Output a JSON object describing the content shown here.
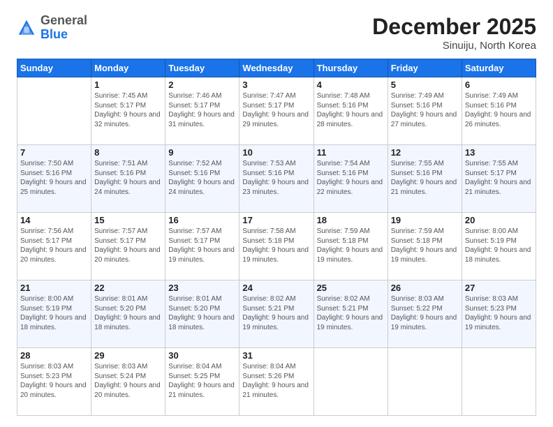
{
  "header": {
    "logo_general": "General",
    "logo_blue": "Blue",
    "month": "December 2025",
    "location": "Sinuiju, North Korea"
  },
  "days_of_week": [
    "Sunday",
    "Monday",
    "Tuesday",
    "Wednesday",
    "Thursday",
    "Friday",
    "Saturday"
  ],
  "weeks": [
    [
      {
        "day": "",
        "sunrise": "",
        "sunset": "",
        "daylight": ""
      },
      {
        "day": "1",
        "sunrise": "Sunrise: 7:45 AM",
        "sunset": "Sunset: 5:17 PM",
        "daylight": "Daylight: 9 hours and 32 minutes."
      },
      {
        "day": "2",
        "sunrise": "Sunrise: 7:46 AM",
        "sunset": "Sunset: 5:17 PM",
        "daylight": "Daylight: 9 hours and 31 minutes."
      },
      {
        "day": "3",
        "sunrise": "Sunrise: 7:47 AM",
        "sunset": "Sunset: 5:17 PM",
        "daylight": "Daylight: 9 hours and 29 minutes."
      },
      {
        "day": "4",
        "sunrise": "Sunrise: 7:48 AM",
        "sunset": "Sunset: 5:16 PM",
        "daylight": "Daylight: 9 hours and 28 minutes."
      },
      {
        "day": "5",
        "sunrise": "Sunrise: 7:49 AM",
        "sunset": "Sunset: 5:16 PM",
        "daylight": "Daylight: 9 hours and 27 minutes."
      },
      {
        "day": "6",
        "sunrise": "Sunrise: 7:49 AM",
        "sunset": "Sunset: 5:16 PM",
        "daylight": "Daylight: 9 hours and 26 minutes."
      }
    ],
    [
      {
        "day": "7",
        "sunrise": "Sunrise: 7:50 AM",
        "sunset": "Sunset: 5:16 PM",
        "daylight": "Daylight: 9 hours and 25 minutes."
      },
      {
        "day": "8",
        "sunrise": "Sunrise: 7:51 AM",
        "sunset": "Sunset: 5:16 PM",
        "daylight": "Daylight: 9 hours and 24 minutes."
      },
      {
        "day": "9",
        "sunrise": "Sunrise: 7:52 AM",
        "sunset": "Sunset: 5:16 PM",
        "daylight": "Daylight: 9 hours and 24 minutes."
      },
      {
        "day": "10",
        "sunrise": "Sunrise: 7:53 AM",
        "sunset": "Sunset: 5:16 PM",
        "daylight": "Daylight: 9 hours and 23 minutes."
      },
      {
        "day": "11",
        "sunrise": "Sunrise: 7:54 AM",
        "sunset": "Sunset: 5:16 PM",
        "daylight": "Daylight: 9 hours and 22 minutes."
      },
      {
        "day": "12",
        "sunrise": "Sunrise: 7:55 AM",
        "sunset": "Sunset: 5:16 PM",
        "daylight": "Daylight: 9 hours and 21 minutes."
      },
      {
        "day": "13",
        "sunrise": "Sunrise: 7:55 AM",
        "sunset": "Sunset: 5:17 PM",
        "daylight": "Daylight: 9 hours and 21 minutes."
      }
    ],
    [
      {
        "day": "14",
        "sunrise": "Sunrise: 7:56 AM",
        "sunset": "Sunset: 5:17 PM",
        "daylight": "Daylight: 9 hours and 20 minutes."
      },
      {
        "day": "15",
        "sunrise": "Sunrise: 7:57 AM",
        "sunset": "Sunset: 5:17 PM",
        "daylight": "Daylight: 9 hours and 20 minutes."
      },
      {
        "day": "16",
        "sunrise": "Sunrise: 7:57 AM",
        "sunset": "Sunset: 5:17 PM",
        "daylight": "Daylight: 9 hours and 19 minutes."
      },
      {
        "day": "17",
        "sunrise": "Sunrise: 7:58 AM",
        "sunset": "Sunset: 5:18 PM",
        "daylight": "Daylight: 9 hours and 19 minutes."
      },
      {
        "day": "18",
        "sunrise": "Sunrise: 7:59 AM",
        "sunset": "Sunset: 5:18 PM",
        "daylight": "Daylight: 9 hours and 19 minutes."
      },
      {
        "day": "19",
        "sunrise": "Sunrise: 7:59 AM",
        "sunset": "Sunset: 5:18 PM",
        "daylight": "Daylight: 9 hours and 19 minutes."
      },
      {
        "day": "20",
        "sunrise": "Sunrise: 8:00 AM",
        "sunset": "Sunset: 5:19 PM",
        "daylight": "Daylight: 9 hours and 18 minutes."
      }
    ],
    [
      {
        "day": "21",
        "sunrise": "Sunrise: 8:00 AM",
        "sunset": "Sunset: 5:19 PM",
        "daylight": "Daylight: 9 hours and 18 minutes."
      },
      {
        "day": "22",
        "sunrise": "Sunrise: 8:01 AM",
        "sunset": "Sunset: 5:20 PM",
        "daylight": "Daylight: 9 hours and 18 minutes."
      },
      {
        "day": "23",
        "sunrise": "Sunrise: 8:01 AM",
        "sunset": "Sunset: 5:20 PM",
        "daylight": "Daylight: 9 hours and 18 minutes."
      },
      {
        "day": "24",
        "sunrise": "Sunrise: 8:02 AM",
        "sunset": "Sunset: 5:21 PM",
        "daylight": "Daylight: 9 hours and 19 minutes."
      },
      {
        "day": "25",
        "sunrise": "Sunrise: 8:02 AM",
        "sunset": "Sunset: 5:21 PM",
        "daylight": "Daylight: 9 hours and 19 minutes."
      },
      {
        "day": "26",
        "sunrise": "Sunrise: 8:03 AM",
        "sunset": "Sunset: 5:22 PM",
        "daylight": "Daylight: 9 hours and 19 minutes."
      },
      {
        "day": "27",
        "sunrise": "Sunrise: 8:03 AM",
        "sunset": "Sunset: 5:23 PM",
        "daylight": "Daylight: 9 hours and 19 minutes."
      }
    ],
    [
      {
        "day": "28",
        "sunrise": "Sunrise: 8:03 AM",
        "sunset": "Sunset: 5:23 PM",
        "daylight": "Daylight: 9 hours and 20 minutes."
      },
      {
        "day": "29",
        "sunrise": "Sunrise: 8:03 AM",
        "sunset": "Sunset: 5:24 PM",
        "daylight": "Daylight: 9 hours and 20 minutes."
      },
      {
        "day": "30",
        "sunrise": "Sunrise: 8:04 AM",
        "sunset": "Sunset: 5:25 PM",
        "daylight": "Daylight: 9 hours and 21 minutes."
      },
      {
        "day": "31",
        "sunrise": "Sunrise: 8:04 AM",
        "sunset": "Sunset: 5:26 PM",
        "daylight": "Daylight: 9 hours and 21 minutes."
      },
      {
        "day": "",
        "sunrise": "",
        "sunset": "",
        "daylight": ""
      },
      {
        "day": "",
        "sunrise": "",
        "sunset": "",
        "daylight": ""
      },
      {
        "day": "",
        "sunrise": "",
        "sunset": "",
        "daylight": ""
      }
    ]
  ]
}
